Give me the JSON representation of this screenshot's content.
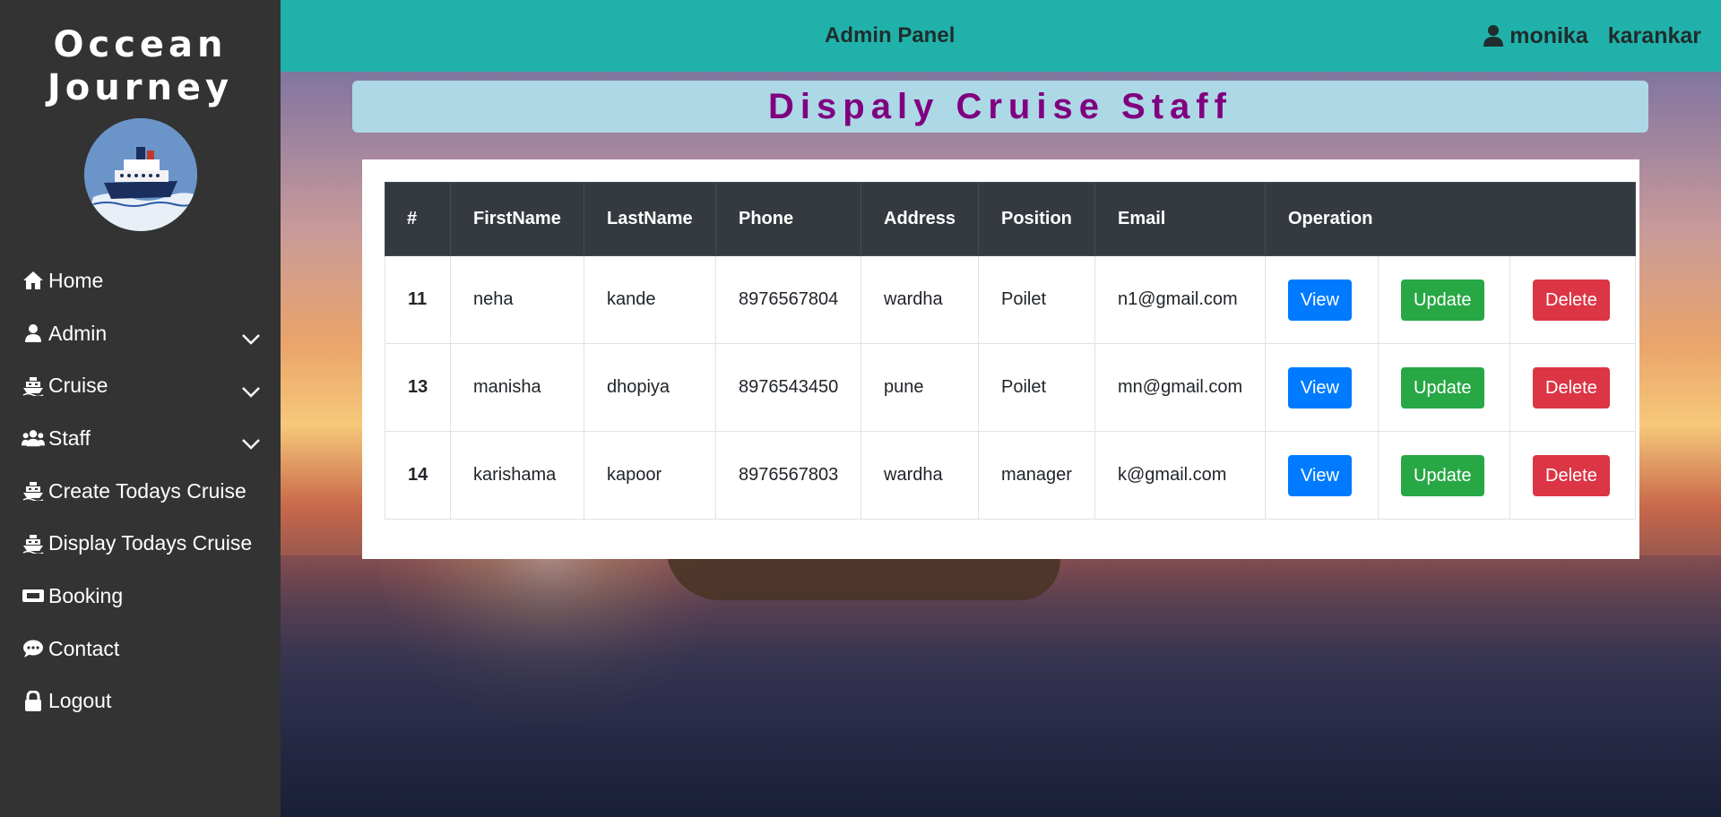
{
  "sidebar": {
    "brand_line1": "Occean",
    "brand_line2": "Journey",
    "items": [
      {
        "label": "Home",
        "icon": "home-icon"
      },
      {
        "label": "Admin",
        "icon": "user-icon",
        "dropdown": true
      },
      {
        "label": "Cruise",
        "icon": "ship-icon",
        "dropdown": true
      },
      {
        "label": "Staff",
        "icon": "users-icon",
        "dropdown": true
      },
      {
        "label": "Create Todays Cruise",
        "icon": "ship-icon"
      },
      {
        "label": "Display Todays Cruise",
        "icon": "ship-icon"
      },
      {
        "label": "Booking",
        "icon": "ticket-icon"
      },
      {
        "label": "Contact",
        "icon": "chat-icon"
      },
      {
        "label": "Logout",
        "icon": "lock-icon"
      }
    ]
  },
  "topbar": {
    "title": "Admin Panel",
    "user_first": "monika",
    "user_last": "karankar"
  },
  "page": {
    "heading": "Dispaly Cruise Staff"
  },
  "table": {
    "headers": [
      "#",
      "FirstName",
      "LastName",
      "Phone",
      "Address",
      "Position",
      "Email",
      "Operation"
    ],
    "rows": [
      {
        "id": "11",
        "first": "neha",
        "last": "kande",
        "phone": "8976567804",
        "address": "wardha",
        "position": "Poilet",
        "email": "n1@gmail.com"
      },
      {
        "id": "13",
        "first": "manisha",
        "last": "dhopiya",
        "phone": "8976543450",
        "address": "pune",
        "position": "Poilet",
        "email": "mn@gmail.com"
      },
      {
        "id": "14",
        "first": "karishama",
        "last": "kapoor",
        "phone": "8976567803",
        "address": "wardha",
        "position": "manager",
        "email": "k@gmail.com"
      }
    ],
    "actions": {
      "view": "View",
      "update": "Update",
      "delete": "Delete"
    }
  },
  "colors": {
    "sidebar_bg": "#333333",
    "topbar_bg": "#20b2aa",
    "heading_bg": "#add8e6",
    "heading_text": "#800080",
    "table_head_bg": "#343a40",
    "view": "#007bff",
    "update": "#28a745",
    "delete": "#dc3545"
  }
}
